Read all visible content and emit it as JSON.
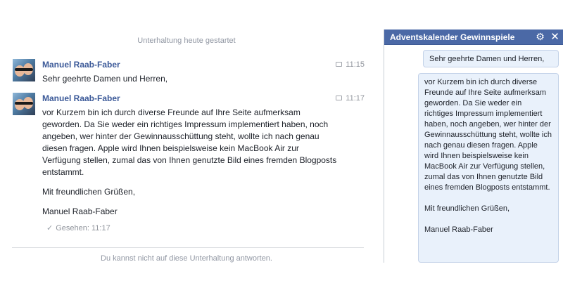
{
  "conversation": {
    "started_label": "Unterhaltung heute gestartet",
    "messages": [
      {
        "sender": "Manuel Raab-Faber",
        "time": "11:15",
        "paragraphs": [
          "Sehr geehrte Damen und Herren,"
        ]
      },
      {
        "sender": "Manuel Raab-Faber",
        "time": "11:17",
        "paragraphs": [
          "vor Kurzem bin ich durch diverse Freunde auf Ihre Seite aufmerksam geworden. Da Sie weder ein richtiges Impressum implementiert haben, noch angeben, wer hinter der Gewinnausschüttung steht, wollte ich nach genau diesen fragen. Apple wird Ihnen beispielsweise kein MacBook Air zur Verfügung stellen, zumal das von Ihnen genutzte Bild eines fremden Blogposts entstammt.",
          "Mit freundlichen Grüßen,",
          "Manuel Raab-Faber"
        ]
      }
    ],
    "seen_label": "Gesehen: 11:17",
    "cannot_reply_label": "Du kannst nicht auf diese Unterhaltung antworten."
  },
  "chat_window": {
    "title": "Adventskalender Gewinnspiele",
    "header_color": "#4b69a6",
    "icons": [
      "gear-icon",
      "close-icon"
    ],
    "bubbles": [
      {
        "paragraphs": [
          "Sehr geehrte Damen und Herren,"
        ]
      },
      {
        "paragraphs": [
          "vor Kurzem bin ich durch diverse Freunde auf Ihre Seite aufmerksam geworden. Da Sie weder ein richtiges Impressum implementiert haben, noch angeben, wer hinter der Gewinnausschüttung steht, wollte ich nach genau diesen fragen. Apple wird Ihnen beispielsweise kein MacBook Air zur Verfügung stellen, zumal das von Ihnen genutzte Bild eines fremden Blogposts entstammt.",
          "Mit freundlichen Grüßen,",
          "Manuel Raab-Faber"
        ]
      }
    ]
  },
  "colors": {
    "sender_link": "#3b5998",
    "bubble_bg": "#e9f1fb",
    "bubble_border": "#c3d2e8",
    "muted_text": "#90949c"
  }
}
